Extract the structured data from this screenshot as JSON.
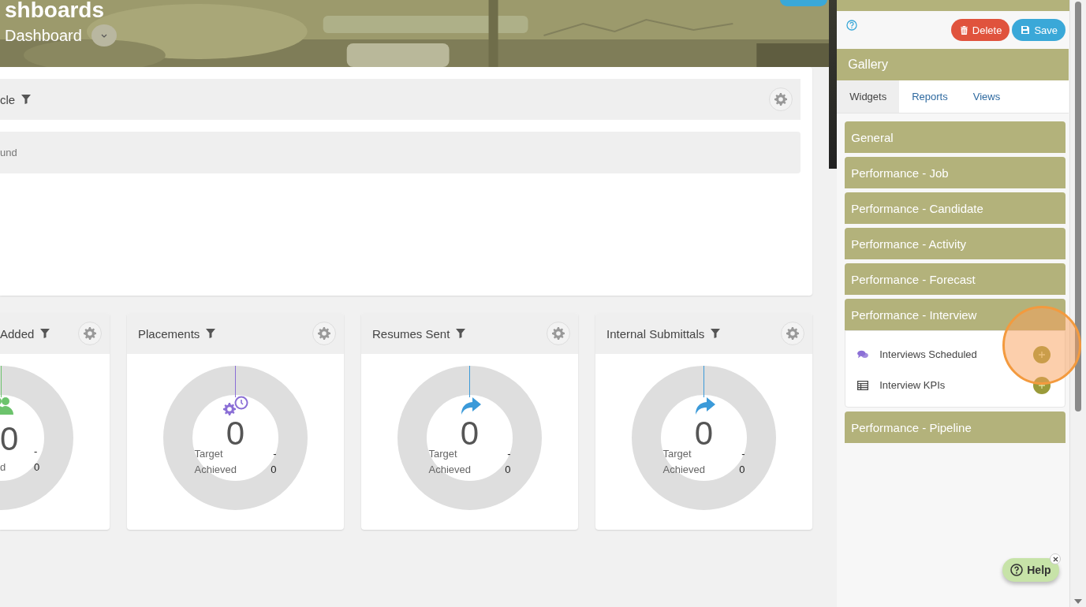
{
  "header": {
    "title": "shboards",
    "subtitle": "Dashboard"
  },
  "top_widget": {
    "title": "cle",
    "message": "und"
  },
  "widgets": [
    {
      "title": "Added",
      "kind": "people",
      "color": "#6cc36c",
      "value": "0",
      "target": "-",
      "achieved_label": "d",
      "achieved": "0"
    },
    {
      "title": "Placements",
      "kind": "gears",
      "color": "#8b6fd6",
      "value": "0",
      "target_label": "Target",
      "target": "-",
      "achieved_label": "Achieved",
      "achieved": "0"
    },
    {
      "title": "Resumes Sent",
      "kind": "share",
      "color": "#3b9ad9",
      "value": "0",
      "target_label": "Target",
      "target": "-",
      "achieved_label": "Achieved",
      "achieved": "0"
    },
    {
      "title": "Internal Submittals",
      "kind": "share",
      "color": "#3b9ad9",
      "value": "0",
      "target_label": "Target",
      "target": "-",
      "achieved_label": "Achieved",
      "achieved": "0"
    }
  ],
  "panel": {
    "buttons": [
      {
        "label": "Delete",
        "kind": "delete"
      },
      {
        "label": "Save",
        "kind": "save"
      }
    ],
    "gallery_title": "Gallery",
    "tabs": [
      {
        "label": "Widgets",
        "selected": true
      },
      {
        "label": "Reports",
        "selected": false
      },
      {
        "label": "Views",
        "selected": false
      }
    ],
    "categories": [
      {
        "label": "General",
        "expanded": false
      },
      {
        "label": "Performance - Job",
        "expanded": false
      },
      {
        "label": "Performance - Candidate",
        "expanded": false
      },
      {
        "label": "Performance - Activity",
        "expanded": false
      },
      {
        "label": "Performance - Forecast",
        "expanded": false
      },
      {
        "label": "Performance - Interview",
        "expanded": true,
        "items": [
          {
            "label": "Interviews Scheduled",
            "kind": "chat"
          },
          {
            "label": "Interview KPIs",
            "kind": "table"
          }
        ]
      },
      {
        "label": "Performance - Pipeline",
        "expanded": false
      }
    ]
  },
  "help": {
    "label": "Help"
  }
}
